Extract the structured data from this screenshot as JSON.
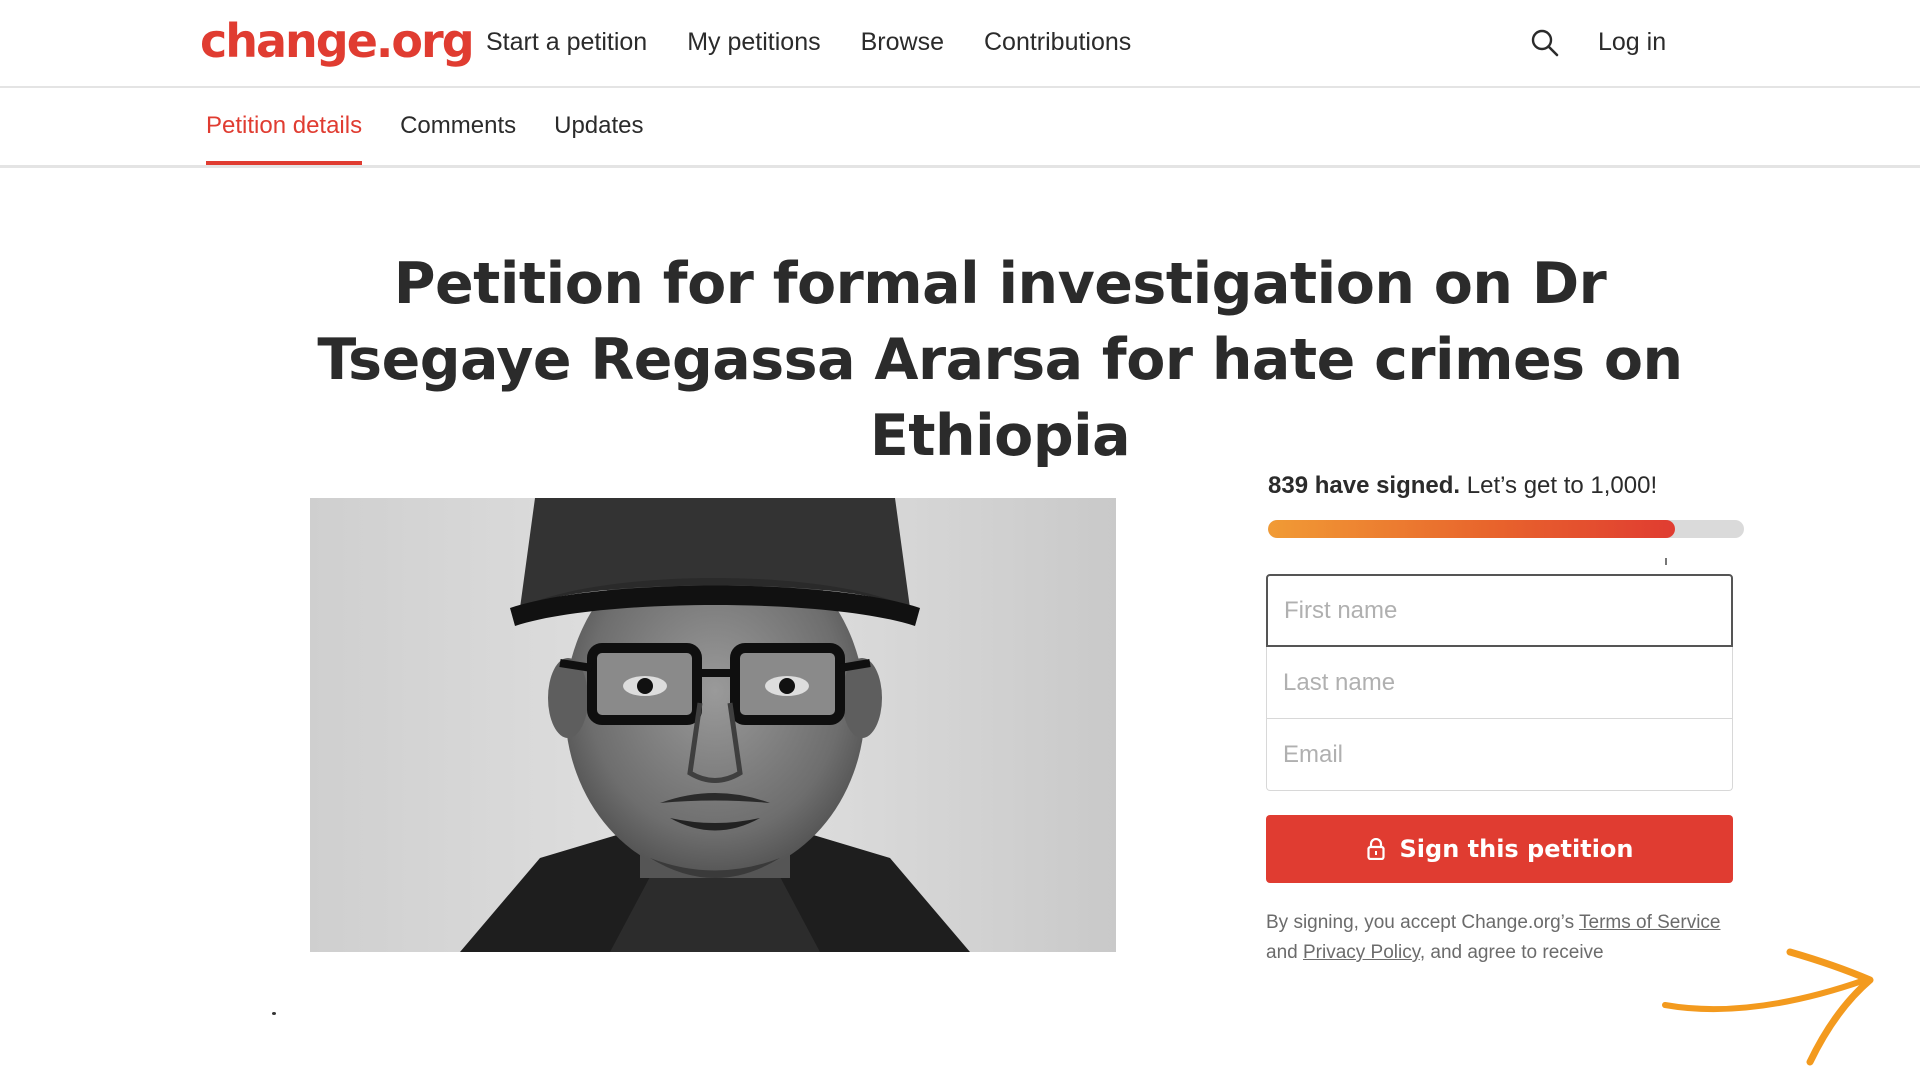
{
  "header": {
    "logo": "change.org",
    "nav": [
      "Start a petition",
      "My petitions",
      "Browse",
      "Contributions"
    ],
    "login": "Log in"
  },
  "tabs": [
    {
      "label": "Petition details",
      "active": true
    },
    {
      "label": "Comments",
      "active": false
    },
    {
      "label": "Updates",
      "active": false
    }
  ],
  "petition": {
    "title": "Petition for formal investigation on Dr Tsegaye Regassa Ararsa for hate crimes on Ethiopia"
  },
  "progress": {
    "signed_bold": "839 have signed.",
    "goal_text": "Let’s get to 1,000!",
    "signed": 839,
    "goal": 1000
  },
  "form": {
    "first_name_placeholder": "First name",
    "last_name_placeholder": "Last name",
    "email_placeholder": "Email",
    "sign_button": "Sign this petition"
  },
  "legal": {
    "prefix": "By signing, you accept Change.org’s ",
    "terms": "Terms of Service",
    "and": " and ",
    "privacy": "Privacy Policy",
    "suffix": ", and agree to receive"
  },
  "colors": {
    "brand": "#e03c31",
    "progress_start": "#f19b35",
    "arrow": "#f39a1e"
  },
  "icons": {
    "search": "search-icon",
    "lock": "lock-icon",
    "arrow": "arrow-right-icon"
  }
}
